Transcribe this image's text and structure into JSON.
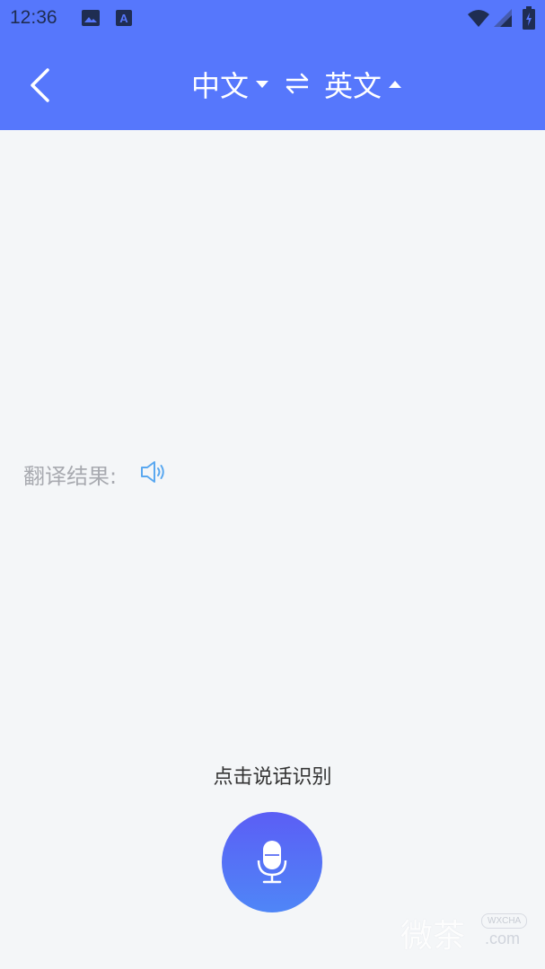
{
  "status": {
    "time": "12:36",
    "icons": [
      "image-icon",
      "text-a-icon",
      "wifi-icon",
      "signal-icon",
      "battery-icon"
    ]
  },
  "header": {
    "source_lang": "中文",
    "target_lang": "英文",
    "icons": [
      "back-arrow-icon",
      "caret-down-icon",
      "swap-icon",
      "caret-up-icon"
    ]
  },
  "result": {
    "label": "翻译结果:"
  },
  "voice": {
    "hint": "点击说话识别"
  },
  "watermark": {
    "brand": "微茶",
    "sub": "WXCHA",
    "domain": ".com"
  },
  "colors": {
    "primary": "#5677fc",
    "background": "#f4f6f8",
    "speaker": "#5aa8f0",
    "mic_top": "#5b5ef5",
    "mic_bottom": "#4f86f7"
  }
}
